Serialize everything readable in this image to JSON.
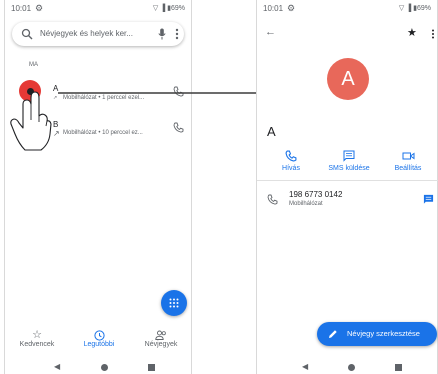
{
  "left_screen": {
    "status_bar": {
      "time": "10:01",
      "icons": "▽ ▐ ▮69%",
      "settings_icon": "gear-icon"
    },
    "search": {
      "placeholder": "Névjegyek és helyek ker...",
      "icon": "search-icon",
      "mic_icon": "mic-icon",
      "menu_icon": "more-vert-icon"
    },
    "section_header": "MA",
    "calls": [
      {
        "name": "A",
        "detail": "Mobilhálózat • 1 perccel ezel...",
        "direction_icon": "outgoing-call-icon"
      },
      {
        "name": "B",
        "detail": "Mobilhálózat • 10 perccel ez...",
        "direction_icon": "outgoing-call-icon"
      }
    ],
    "bottom_nav": [
      {
        "label": "Kedvencek",
        "icon": "star-outline-icon",
        "active": false
      },
      {
        "label": "Legutóbbi",
        "icon": "clock-icon",
        "active": true
      },
      {
        "label": "Névjegyek",
        "icon": "people-icon",
        "active": false
      }
    ]
  },
  "right_screen": {
    "status_bar": {
      "time": "10:01",
      "icons": "▽ ▐ ▮69%",
      "settings_icon": "gear-icon"
    },
    "avatar_letter": "A",
    "contact_name": "A",
    "actions": [
      {
        "label": "Hívás",
        "icon": "phone-icon"
      },
      {
        "label": "SMS küldése",
        "icon": "message-icon"
      },
      {
        "label": "Beállítás",
        "icon": "video-icon"
      }
    ],
    "phone_number": "198 6773 0142",
    "phone_type": "Mobilhálózat",
    "edit_button": "Névjegy szerkesztése"
  },
  "colors": {
    "accent": "#1a73e8",
    "avatar": "#e8685a",
    "highlight": "#e53935"
  }
}
